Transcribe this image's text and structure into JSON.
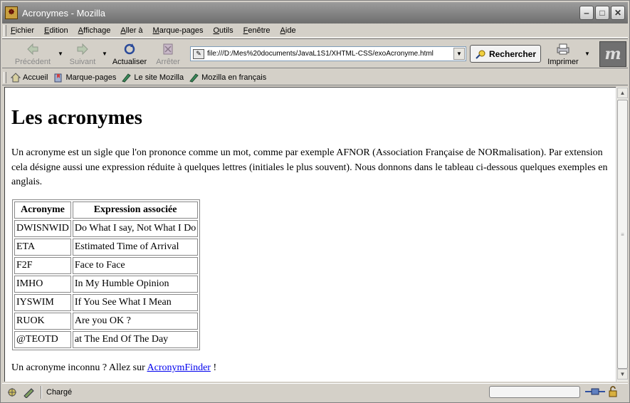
{
  "window": {
    "title": "Acronymes - Mozilla",
    "app_icon_glyph": "☸",
    "minimize_glyph": "‒",
    "maximize_glyph": "□",
    "close_glyph": "✕"
  },
  "menu": {
    "items": [
      "Fichier",
      "Edition",
      "Affichage",
      "Aller à",
      "Marque-pages",
      "Outils",
      "Fenêtre",
      "Aide"
    ]
  },
  "navbar": {
    "back_label": "Précédent",
    "forward_label": "Suivant",
    "reload_label": "Actualiser",
    "stop_label": "Arrêter",
    "url": "file:///D:/Mes%20documents/JavaL1S1/XHTML-CSS/exoAcronyme.html",
    "search_label": "Rechercher",
    "print_label": "Imprimer",
    "throbber_glyph": "m"
  },
  "personal_toolbar": {
    "items": [
      "Accueil",
      "Marque-pages",
      "Le site Mozilla",
      "Mozilla en français"
    ]
  },
  "page": {
    "heading": "Les acronymes",
    "intro": "Un acronyme est un sigle que l'on prononce comme un mot, comme par exemple AFNOR (Association Française de NORmalisation). Par extension cela désigne aussi une expression réduite à quelques lettres (initiales le plus souvent). Nous donnons dans le tableau ci-dessous quelques exemples en anglais.",
    "table": {
      "headers": [
        "Acronyme",
        "Expression associée"
      ],
      "rows": [
        [
          "DWISNWID",
          "Do What I say, Not What I Do"
        ],
        [
          "ETA",
          "Estimated Time of Arrival"
        ],
        [
          "F2F",
          "Face to Face"
        ],
        [
          "IMHO",
          "In My Humble Opinion"
        ],
        [
          "IYSWIM",
          "If You See What I Mean"
        ],
        [
          "RUOK",
          "Are you OK ?"
        ],
        [
          "@TEOTD",
          "at The End Of The Day"
        ]
      ]
    },
    "footer_text": "Un acronyme inconnu ? Allez sur",
    "footer_link": "AcronymFinder",
    "footer_end": "!"
  },
  "status": {
    "text": "Chargé"
  },
  "colors": {
    "link": "#0000ee",
    "chrome": "#d4d0c8",
    "titlebar": "#6e6e6e"
  }
}
